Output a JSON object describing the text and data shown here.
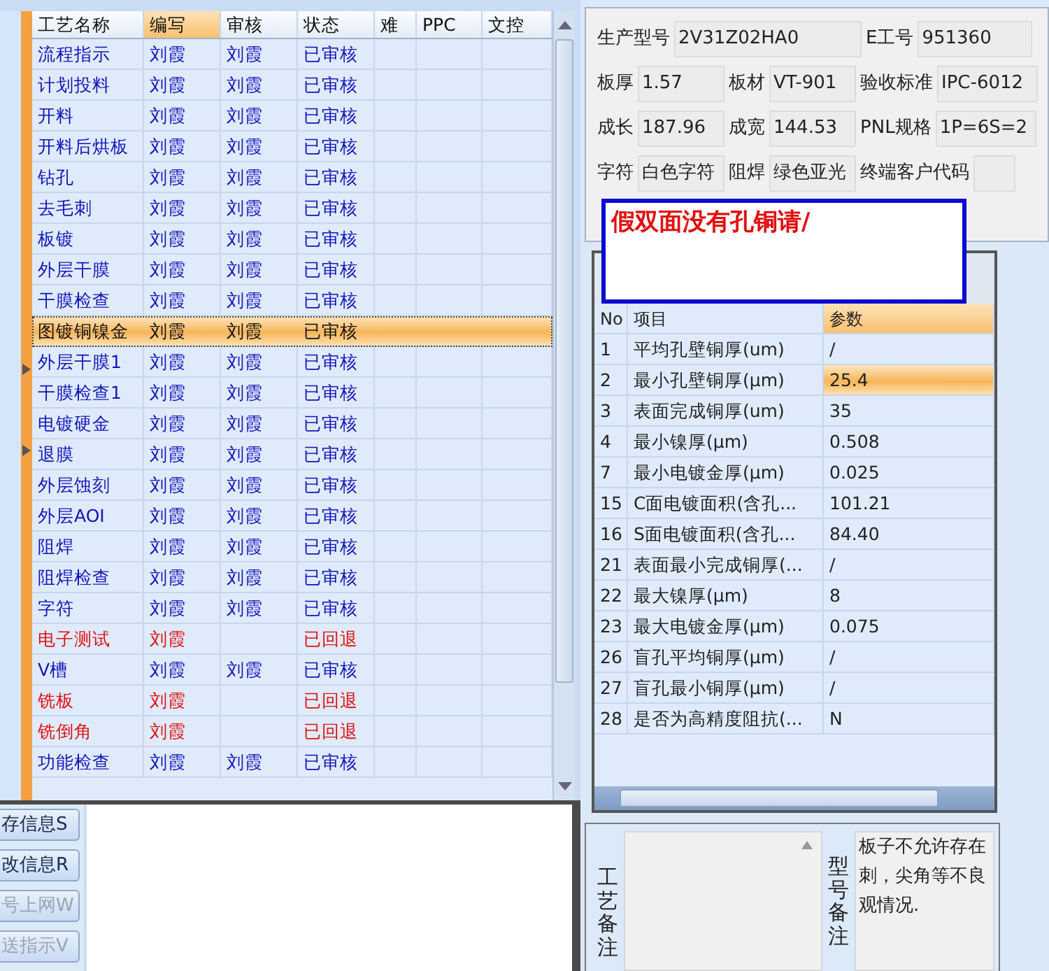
{
  "process_table": {
    "columns": [
      {
        "label": "工艺名称",
        "selected": false
      },
      {
        "label": "编写",
        "selected": true
      },
      {
        "label": "审核",
        "selected": false
      },
      {
        "label": "状态",
        "selected": false
      },
      {
        "label": "难",
        "selected": false
      },
      {
        "label": "PPC",
        "selected": false
      },
      {
        "label": "文控",
        "selected": false
      }
    ],
    "rows": [
      {
        "name": "流程指示",
        "writer": "刘霞",
        "reviewer": "刘霞",
        "status": "已审核",
        "returned": false,
        "selected": false
      },
      {
        "name": "计划投料",
        "writer": "刘霞",
        "reviewer": "刘霞",
        "status": "已审核",
        "returned": false,
        "selected": false
      },
      {
        "name": "开料",
        "writer": "刘霞",
        "reviewer": "刘霞",
        "status": "已审核",
        "returned": false,
        "selected": false
      },
      {
        "name": "开料后烘板",
        "writer": "刘霞",
        "reviewer": "刘霞",
        "status": "已审核",
        "returned": false,
        "selected": false
      },
      {
        "name": "钻孔",
        "writer": "刘霞",
        "reviewer": "刘霞",
        "status": "已审核",
        "returned": false,
        "selected": false
      },
      {
        "name": "去毛刺",
        "writer": "刘霞",
        "reviewer": "刘霞",
        "status": "已审核",
        "returned": false,
        "selected": false
      },
      {
        "name": "板镀",
        "writer": "刘霞",
        "reviewer": "刘霞",
        "status": "已审核",
        "returned": false,
        "selected": false
      },
      {
        "name": "外层干膜",
        "writer": "刘霞",
        "reviewer": "刘霞",
        "status": "已审核",
        "returned": false,
        "selected": false
      },
      {
        "name": "干膜检查",
        "writer": "刘霞",
        "reviewer": "刘霞",
        "status": "已审核",
        "returned": false,
        "selected": false
      },
      {
        "name": "图镀铜镍金",
        "writer": "刘霞",
        "reviewer": "刘霞",
        "status": "已审核",
        "returned": false,
        "selected": true
      },
      {
        "name": "外层干膜1",
        "writer": "刘霞",
        "reviewer": "刘霞",
        "status": "已审核",
        "returned": false,
        "selected": false
      },
      {
        "name": "干膜检查1",
        "writer": "刘霞",
        "reviewer": "刘霞",
        "status": "已审核",
        "returned": false,
        "selected": false
      },
      {
        "name": "电镀硬金",
        "writer": "刘霞",
        "reviewer": "刘霞",
        "status": "已审核",
        "returned": false,
        "selected": false
      },
      {
        "name": "退膜",
        "writer": "刘霞",
        "reviewer": "刘霞",
        "status": "已审核",
        "returned": false,
        "selected": false
      },
      {
        "name": "外层蚀刻",
        "writer": "刘霞",
        "reviewer": "刘霞",
        "status": "已审核",
        "returned": false,
        "selected": false
      },
      {
        "name": "外层AOI",
        "writer": "刘霞",
        "reviewer": "刘霞",
        "status": "已审核",
        "returned": false,
        "selected": false
      },
      {
        "name": "阻焊",
        "writer": "刘霞",
        "reviewer": "刘霞",
        "status": "已审核",
        "returned": false,
        "selected": false
      },
      {
        "name": "阻焊检查",
        "writer": "刘霞",
        "reviewer": "刘霞",
        "status": "已审核",
        "returned": false,
        "selected": false
      },
      {
        "name": "字符",
        "writer": "刘霞",
        "reviewer": "刘霞",
        "status": "已审核",
        "returned": false,
        "selected": false
      },
      {
        "name": "电子测试",
        "writer": "刘霞",
        "status": "已回退",
        "returned": true,
        "selected": false
      },
      {
        "name": "V槽",
        "writer": "刘霞",
        "reviewer": "刘霞",
        "status": "已审核",
        "returned": false,
        "selected": false
      },
      {
        "name": "铣板",
        "writer": "刘霞",
        "status": "已回退",
        "returned": true,
        "selected": false
      },
      {
        "name": "铣倒角",
        "writer": "刘霞",
        "status": "已回退",
        "returned": true,
        "selected": false
      },
      {
        "name": "功能检查",
        "writer": "刘霞",
        "reviewer": "刘霞",
        "status": "已审核",
        "returned": false,
        "selected": false
      }
    ]
  },
  "buttons": [
    {
      "label": "存信息S",
      "disabled": false
    },
    {
      "label": "改信息R",
      "disabled": false
    },
    {
      "label": "号上网W",
      "disabled": true
    },
    {
      "label": "送指示V",
      "disabled": true
    }
  ],
  "form": {
    "fields": [
      {
        "label": "生产型号",
        "value": "2V31Z02HA0"
      },
      {
        "label": "E工号",
        "value": "951360"
      },
      {
        "label": "板厚",
        "value": "1.57"
      },
      {
        "label": "板材",
        "value": "VT-901"
      },
      {
        "label": "验收标准",
        "value": "IPC-6012"
      },
      {
        "label": "成长",
        "value": "187.96"
      },
      {
        "label": "成宽",
        "value": "144.53"
      },
      {
        "label": "PNL规格",
        "value": "1P=6S=2"
      },
      {
        "label": "字符",
        "value": "白色字符"
      },
      {
        "label": "阻焊",
        "value": "绿色亚光"
      },
      {
        "label": "终端客户代码"
      }
    ]
  },
  "notice": "假双面没有孔铜请/",
  "param_table": {
    "columns": [
      "No",
      "项目",
      "参数"
    ],
    "rows": [
      {
        "no": "1",
        "item": "平均孔壁铜厚(um)",
        "value": "/",
        "selected": false
      },
      {
        "no": "2",
        "item": "最小孔壁铜厚(μm)",
        "value": "25.4",
        "selected": true
      },
      {
        "no": "3",
        "item": "表面完成铜厚(um)",
        "value": "35",
        "selected": false
      },
      {
        "no": "4",
        "item": "最小镍厚(μm)",
        "value": "0.508",
        "selected": false
      },
      {
        "no": "7",
        "item": "最小电镀金厚(μm)",
        "value": "0.025",
        "selected": false
      },
      {
        "no": "15",
        "item": "C面电镀面积(含孔...",
        "value": "101.21",
        "selected": false
      },
      {
        "no": "16",
        "item": "S面电镀面积(含孔...",
        "value": "84.40",
        "selected": false
      },
      {
        "no": "21",
        "item": "表面最小完成铜厚(...",
        "value": "/",
        "selected": false
      },
      {
        "no": "22",
        "item": "最大镍厚(μm)",
        "value": "8",
        "selected": false
      },
      {
        "no": "23",
        "item": "最大电镀金厚(μm)",
        "value": "0.075",
        "selected": false
      },
      {
        "no": "26",
        "item": "盲孔平均铜厚(μm)",
        "value": "/",
        "selected": false
      },
      {
        "no": "27",
        "item": "盲孔最小铜厚(μm)",
        "value": "/",
        "selected": false
      },
      {
        "no": "28",
        "item": "是否为高精度阻抗(...",
        "value": "N",
        "selected": false
      }
    ]
  },
  "remarks": {
    "process_label": "工艺备注",
    "model_label": "型号备注",
    "model_text": "板子不允许存在刺，尖角等不良观情况."
  }
}
